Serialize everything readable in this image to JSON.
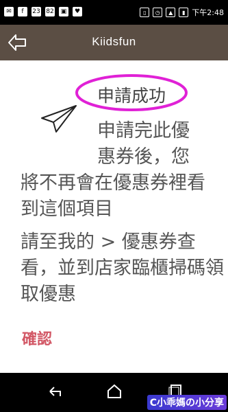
{
  "status_bar": {
    "time": "下午2:48",
    "icons": [
      "message-icon",
      "facebook-icon",
      "calendar-icon",
      "badge-icon",
      "gallery-icon",
      "heart-icon",
      "vibrate-icon",
      "alarm-icon",
      "signal-icon",
      "battery-icon"
    ],
    "calendar_day": "23",
    "badge_count": "82"
  },
  "app_bar": {
    "title": "Kiidsfun",
    "back_icon": "back-arrow-icon"
  },
  "dialog": {
    "title": "申請成功",
    "message_line_1": "申請完此優惠券後，您",
    "message_line_2": "將不再會在優惠券裡看到這個項目",
    "message_line_3": "請至我的 > 優惠券查看，並到店家臨櫃掃碼領取優惠",
    "confirm_label": "確認",
    "highlight_color": "#e021d6",
    "confirm_color": "#d25765"
  },
  "nav_bar": {
    "icons": [
      "nav-back-icon",
      "nav-home-icon",
      "nav-recent-icon"
    ]
  },
  "watermark": {
    "text": "C小乖媽の小分享"
  }
}
